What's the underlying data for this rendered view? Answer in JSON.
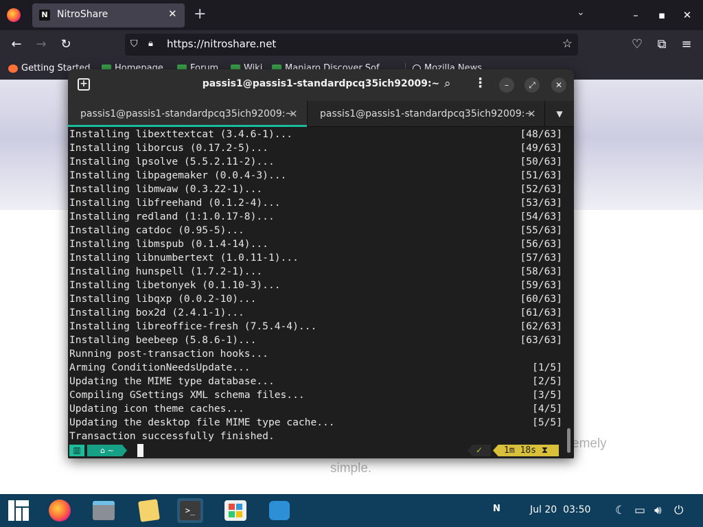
{
  "browser": {
    "tab_title": "NitroShare",
    "tab_favicon": "N",
    "url": "https://nitroshare.net",
    "bookmarks": [
      "Getting Started",
      "Homepage",
      "Forum",
      "Wiki",
      "Manjaro Discover Sof...",
      "Mozilla News"
    ]
  },
  "webpage": {
    "text_line1": "emely",
    "text_line2": "simple."
  },
  "terminal": {
    "title": "passis1@passis1-standardpcq35ich92009:~",
    "tabs": [
      {
        "label": "passis1@passis1-standardpcq35ich92009:~"
      },
      {
        "label": "passis1@passis1-standardpcq35ich92009:~"
      }
    ],
    "lines": [
      {
        "text": "Installing libexttextcat (3.4.6-1)...",
        "count": "[48/63]"
      },
      {
        "text": "Installing liborcus (0.17.2-5)...",
        "count": "[49/63]"
      },
      {
        "text": "Installing lpsolve (5.5.2.11-2)...",
        "count": "[50/63]"
      },
      {
        "text": "Installing libpagemaker (0.0.4-3)...",
        "count": "[51/63]"
      },
      {
        "text": "Installing libmwaw (0.3.22-1)...",
        "count": "[52/63]"
      },
      {
        "text": "Installing libfreehand (0.1.2-4)...",
        "count": "[53/63]"
      },
      {
        "text": "Installing redland (1:1.0.17-8)...",
        "count": "[54/63]"
      },
      {
        "text": "Installing catdoc (0.95-5)...",
        "count": "[55/63]"
      },
      {
        "text": "Installing libmspub (0.1.4-14)...",
        "count": "[56/63]"
      },
      {
        "text": "Installing libnumbertext (1.0.11-1)...",
        "count": "[57/63]"
      },
      {
        "text": "Installing hunspell (1.7.2-1)...",
        "count": "[58/63]"
      },
      {
        "text": "Installing libetonyek (0.1.10-3)...",
        "count": "[59/63]"
      },
      {
        "text": "Installing libqxp (0.0.2-10)...",
        "count": "[60/63]"
      },
      {
        "text": "Installing box2d (2.4.1-1)...",
        "count": "[61/63]"
      },
      {
        "text": "Installing libreoffice-fresh (7.5.4-4)...",
        "count": "[62/63]"
      },
      {
        "text": "Installing beebeep (5.8.6-1)...",
        "count": "[63/63]"
      },
      {
        "text": "Running post-transaction hooks...",
        "count": ""
      },
      {
        "text": "Arming ConditionNeedsUpdate...",
        "count": "[1/5]"
      },
      {
        "text": "Updating the MIME type database...",
        "count": "[2/5]"
      },
      {
        "text": "Compiling GSettings XML schema files...",
        "count": "[3/5]"
      },
      {
        "text": "Updating icon theme caches...",
        "count": "[4/5]"
      },
      {
        "text": "Updating the desktop file MIME type cache...",
        "count": "[5/5]"
      },
      {
        "text": "Transaction successfully finished.",
        "count": ""
      }
    ],
    "prompt": {
      "home": "~",
      "status_ok": "✓",
      "elapsed": "1m 18s"
    }
  },
  "taskbar": {
    "clock_date": "Jul 20",
    "clock_time": "03:50",
    "tray_app": "N"
  },
  "colors": {
    "accent": "#1abc9c",
    "taskbar": "#0f3d5c",
    "timer": "#d8c03a"
  }
}
